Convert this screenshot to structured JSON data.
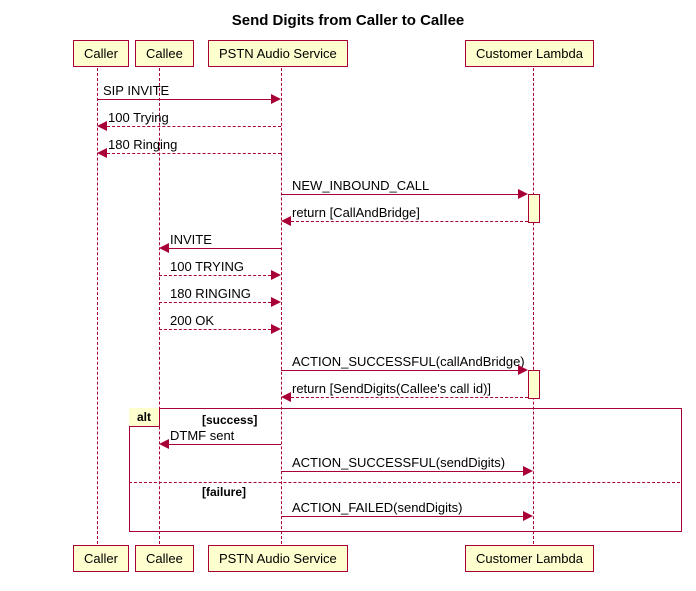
{
  "title": "Send Digits from Caller to Callee",
  "participants": {
    "p0": "Caller",
    "p1": "Callee",
    "p2": "PSTN Audio Service",
    "p3": "Customer Lambda"
  },
  "messages": {
    "m0": "SIP INVITE",
    "m1": "100 Trying",
    "m2": "180 Ringing",
    "m3": "NEW_INBOUND_CALL",
    "m4": "return [CallAndBridge]",
    "m5": "INVITE",
    "m6": "100 TRYING",
    "m7": "180 RINGING",
    "m8": "200 OK",
    "m9": "ACTION_SUCCESSFUL(callAndBridge)",
    "m10": "return [SendDigits(Callee's call id)]",
    "m11": "DTMF sent",
    "m12": "ACTION_SUCCESSFUL(sendDigits)",
    "m13": "ACTION_FAILED(sendDigits)"
  },
  "alt": {
    "label": "alt",
    "cond1": "[success]",
    "cond2": "[failure]"
  }
}
